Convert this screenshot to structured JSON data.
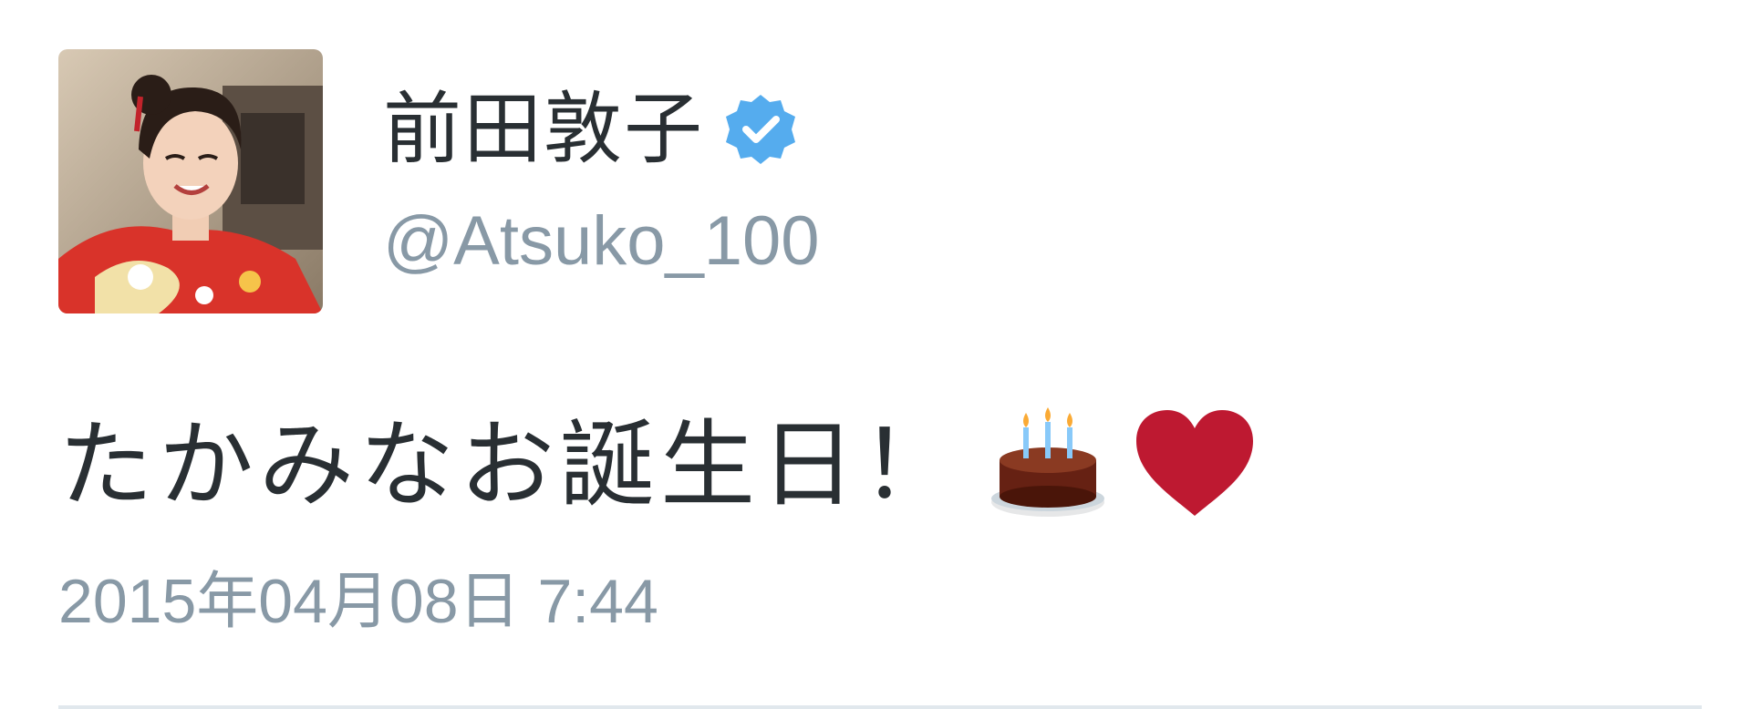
{
  "user": {
    "display_name": "前田敦子",
    "handle": "@Atsuko_100",
    "verified": true,
    "avatar_icon": "profile-photo"
  },
  "tweet": {
    "text": "たかみなお誕生日！",
    "emojis": [
      "birthday-cake-icon",
      "red-heart-icon"
    ],
    "timestamp": "2015年04月08日 7:44"
  },
  "colors": {
    "text": "#292f33",
    "secondary_text": "#8899a6",
    "verified_badge": "#55acee",
    "heart": "#be1931",
    "divider": "#e1e8ed"
  }
}
